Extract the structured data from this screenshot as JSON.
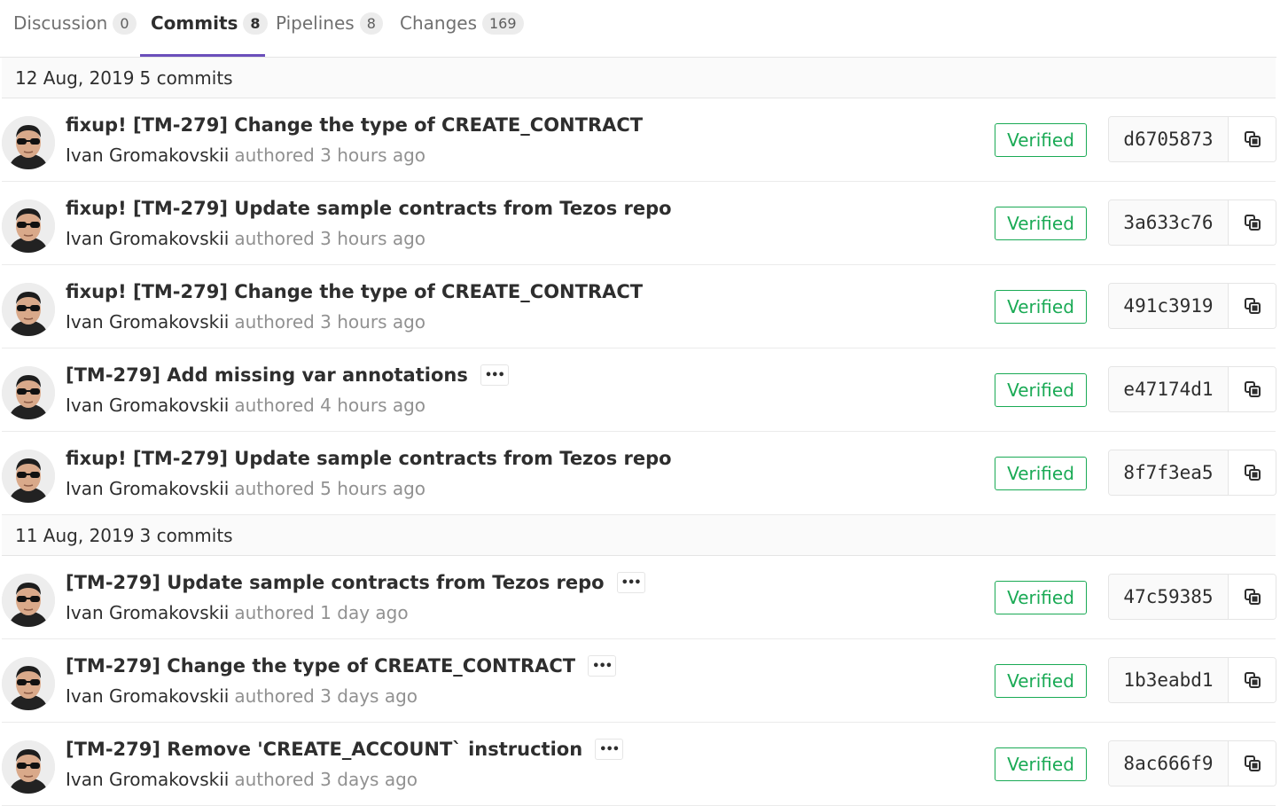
{
  "tabs": [
    {
      "label": "Discussion",
      "count": "0"
    },
    {
      "label": "Commits",
      "count": "8"
    },
    {
      "label": "Pipelines",
      "count": "8"
    },
    {
      "label": "Changes",
      "count": "169"
    }
  ],
  "groups": [
    {
      "date": "12 Aug, 2019",
      "count_label": "5 commits",
      "commits": [
        {
          "title": "fixup! [TM-279] Change the type of CREATE_CONTRACT",
          "author": "Ivan Gromakovskii",
          "authored": "authored 3 hours ago",
          "verified": "Verified",
          "sha": "d6705873",
          "has_ellipsis": false
        },
        {
          "title": "fixup! [TM-279] Update sample contracts from Tezos repo",
          "author": "Ivan Gromakovskii",
          "authored": "authored 3 hours ago",
          "verified": "Verified",
          "sha": "3a633c76",
          "has_ellipsis": false
        },
        {
          "title": "fixup! [TM-279] Change the type of CREATE_CONTRACT",
          "author": "Ivan Gromakovskii",
          "authored": "authored 3 hours ago",
          "verified": "Verified",
          "sha": "491c3919",
          "has_ellipsis": false
        },
        {
          "title": "[TM-279] Add missing var annotations",
          "author": "Ivan Gromakovskii",
          "authored": "authored 4 hours ago",
          "verified": "Verified",
          "sha": "e47174d1",
          "has_ellipsis": true
        },
        {
          "title": "fixup! [TM-279] Update sample contracts from Tezos repo",
          "author": "Ivan Gromakovskii",
          "authored": "authored 5 hours ago",
          "verified": "Verified",
          "sha": "8f7f3ea5",
          "has_ellipsis": false
        }
      ]
    },
    {
      "date": "11 Aug, 2019",
      "count_label": "3 commits",
      "commits": [
        {
          "title": "[TM-279] Update sample contracts from Tezos repo",
          "author": "Ivan Gromakovskii",
          "authored": "authored 1 day ago",
          "verified": "Verified",
          "sha": "47c59385",
          "has_ellipsis": true
        },
        {
          "title": "[TM-279] Change the type of CREATE_CONTRACT",
          "author": "Ivan Gromakovskii",
          "authored": "authored 3 days ago",
          "verified": "Verified",
          "sha": "1b3eabd1",
          "has_ellipsis": true
        },
        {
          "title": "[TM-279] Remove 'CREATE_ACCOUNT` instruction",
          "author": "Ivan Gromakovskii",
          "authored": "authored 3 days ago",
          "verified": "Verified",
          "sha": "8ac666f9",
          "has_ellipsis": true
        }
      ]
    }
  ],
  "ellipsis_glyph": "•••",
  "colors": {
    "accent": "#6b4fbb",
    "verified": "#1aaa55"
  },
  "icons": {
    "copy": "copy-icon",
    "avatar": "user-avatar"
  }
}
